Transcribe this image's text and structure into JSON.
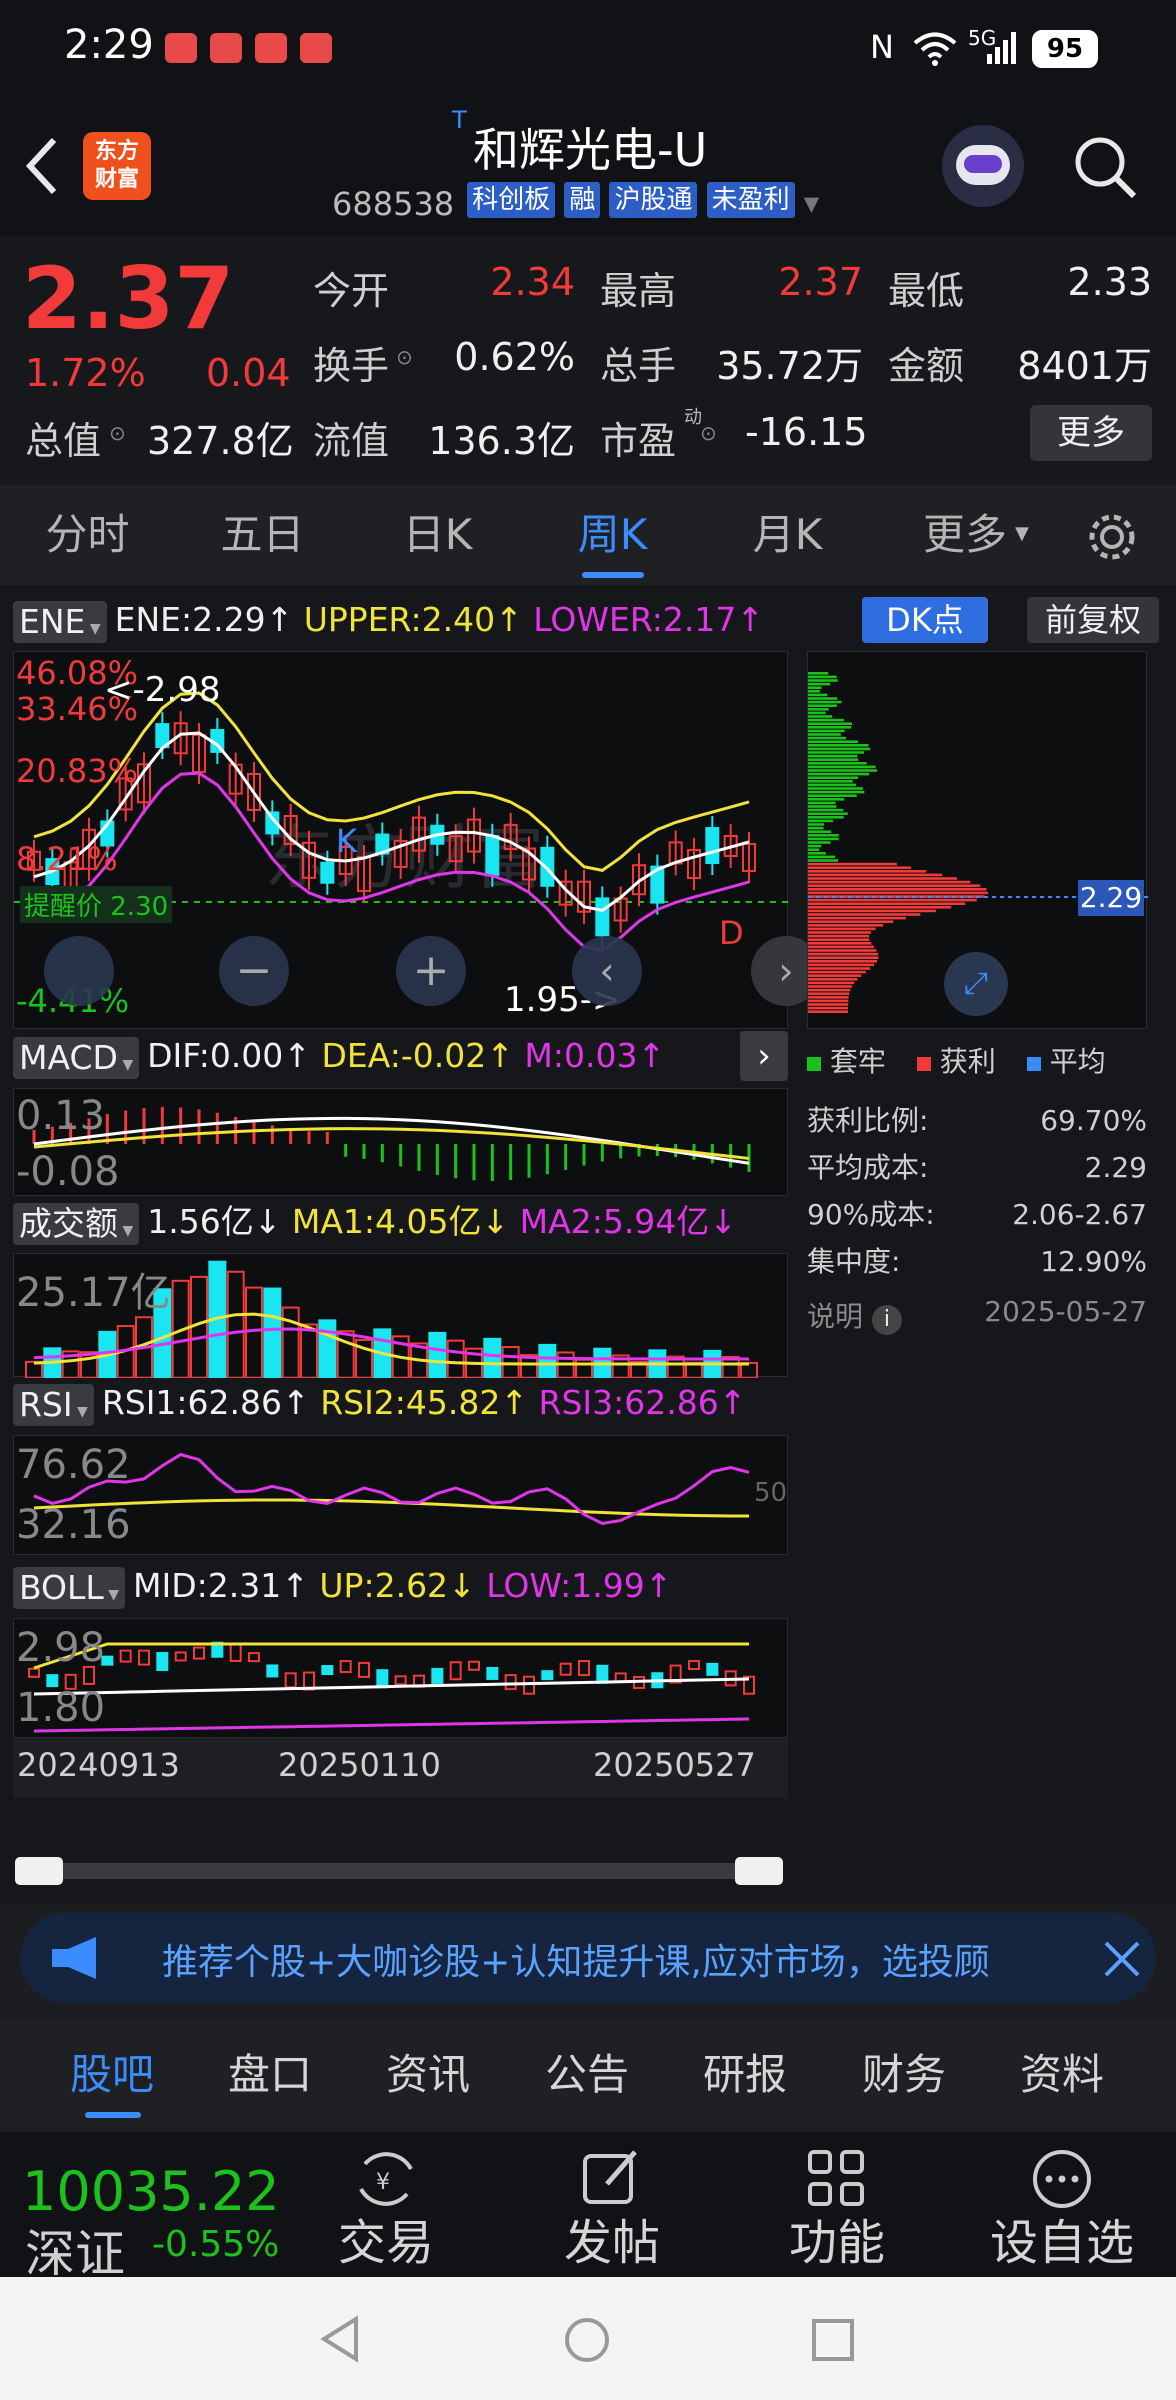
{
  "status": {
    "time": "2:29",
    "battery": "95",
    "network": "5G"
  },
  "header": {
    "logo_text": "东方\n财富",
    "superscript": "T",
    "stock_name": "和辉光电-U",
    "code": "688538",
    "tags": [
      "科创板",
      "融",
      "沪股通",
      "未盈利"
    ]
  },
  "quote": {
    "price": "2.37",
    "change_pct": "1.72%",
    "change": "0.04",
    "total_value_label": "总值",
    "total_value": "327.8亿",
    "fields": [
      {
        "label": "今开",
        "value": "2.34"
      },
      {
        "label": "最高",
        "value": "2.37"
      },
      {
        "label": "最低",
        "value": "2.33"
      },
      {
        "label": "换手",
        "value": "0.62%"
      },
      {
        "label": "总手",
        "value": "35.72万"
      },
      {
        "label": "金额",
        "value": "8401万"
      },
      {
        "label": "流值",
        "value": "136.3亿"
      },
      {
        "label": "市盈",
        "value": "-16.15"
      }
    ],
    "pe_sup": "动",
    "more_button": "更多"
  },
  "tabs": [
    "分时",
    "五日",
    "日K",
    "周K",
    "月K",
    "更多"
  ],
  "active_tab": 3,
  "main_chart": {
    "indicator": "ENE",
    "ene": "ENE:2.29↑",
    "upper": "UPPER:2.40↑",
    "lower": "LOWER:2.17↑",
    "dk_button": "DK点",
    "adjust_button": "前复权",
    "y_labels": [
      "46.08%",
      "33.46%",
      "20.83%",
      "8.21%",
      "-4.41%"
    ],
    "high_marker": "<-2.98",
    "low_marker": "1.95->",
    "alert_label": "提醒价 2.30",
    "k_marker": "K",
    "d_marker": "D",
    "watermark": "东方财富"
  },
  "chip_dist": {
    "price_tag": "2.29",
    "legend": [
      "套牢",
      "获利",
      "平均"
    ],
    "rows": [
      {
        "label": "获利比例:",
        "value": "69.70%"
      },
      {
        "label": "平均成本:",
        "value": "2.29"
      },
      {
        "label": "90%成本:",
        "value": "2.06-2.67"
      },
      {
        "label": "集中度:",
        "value": "12.90%"
      }
    ],
    "note_label": "说明",
    "date": "2025-05-27"
  },
  "macd": {
    "name": "MACD",
    "dif": "DIF:0.00↑",
    "dea": "DEA:-0.02↑",
    "m": "M:0.03↑",
    "y_top": "0.13",
    "y_bottom": "-0.08"
  },
  "volume": {
    "name": "成交额",
    "value": "1.56亿↓",
    "ma1": "MA1:4.05亿↓",
    "ma2": "MA2:5.94亿↓",
    "y_top": "25.17亿"
  },
  "rsi": {
    "name": "RSI",
    "rsi1": "RSI1:62.86↑",
    "rsi2": "RSI2:45.82↑",
    "rsi3": "RSI3:62.86↑",
    "y_top": "76.62",
    "y_bottom": "32.16",
    "mid": "50"
  },
  "boll": {
    "name": "BOLL",
    "mid": "MID:2.31↑",
    "up": "UP:2.62↓",
    "low": "LOW:1.99↑",
    "y_top": "2.98",
    "y_bottom": "1.80"
  },
  "x_dates": [
    "20240913",
    "20250110",
    "20250527"
  ],
  "banner": {
    "text": "推荐个股+大咖诊股+认知提升课,应对市场，选投顾"
  },
  "bottom_tabs": [
    "股吧",
    "盘口",
    "资讯",
    "公告",
    "研报",
    "财务",
    "资料"
  ],
  "index": {
    "value": "10035.22",
    "name": "深证",
    "change": "-0.55%"
  },
  "toolbar": [
    "交易",
    "发帖",
    "功能",
    "设自选"
  ],
  "colors": {
    "up": "#f23a3a",
    "down": "#1bc21b",
    "accent": "#3b8cff",
    "cyan": "#19e6f0"
  }
}
